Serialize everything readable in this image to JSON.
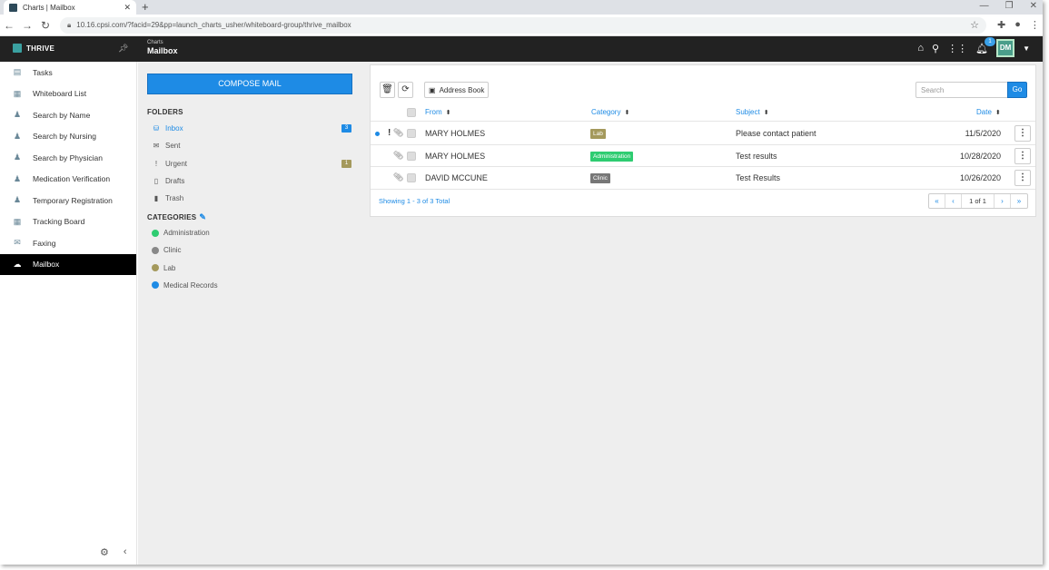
{
  "browser": {
    "tab_title": "Charts | Mailbox",
    "tab_close": "✕",
    "new_tab": "+",
    "url": "10.16.cpsi.com/?facid=29&pp=launch_charts_usher/whiteboard-group/thrive_mailbox"
  },
  "app": {
    "brand": "THRIVE",
    "breadcrumb_sub": "Charts",
    "breadcrumb_title": "Mailbox",
    "notification_count": "1",
    "user_initials": "DM"
  },
  "sidebar": {
    "items": [
      {
        "label": "Tasks",
        "icon": "tasks-icon",
        "glyph": "▤"
      },
      {
        "label": "Whiteboard List",
        "icon": "whiteboard-icon",
        "glyph": "▦"
      },
      {
        "label": "Search by Name",
        "icon": "user-search-icon",
        "glyph": "♟"
      },
      {
        "label": "Search by Nursing",
        "icon": "nurse-icon",
        "glyph": "♟"
      },
      {
        "label": "Search by Physician",
        "icon": "physician-icon",
        "glyph": "♟"
      },
      {
        "label": "Medication Verification",
        "icon": "medication-icon",
        "glyph": "♟"
      },
      {
        "label": "Temporary Registration",
        "icon": "registration-icon",
        "glyph": "♟"
      },
      {
        "label": "Tracking Board",
        "icon": "tracking-board-icon",
        "glyph": "▦"
      },
      {
        "label": "Faxing",
        "icon": "fax-icon",
        "glyph": "✉"
      },
      {
        "label": "Mailbox",
        "icon": "mailbox-icon",
        "glyph": "☁"
      }
    ]
  },
  "mail": {
    "compose_label": "COMPOSE MAIL",
    "folders_heading": "FOLDERS",
    "folders": [
      {
        "label": "Inbox",
        "icon": "inbox-icon",
        "glyph": "⛁",
        "badge": "3",
        "badge_color": "#1e8be5"
      },
      {
        "label": "Sent",
        "icon": "sent-icon",
        "glyph": "✉",
        "badge": "",
        "badge_color": ""
      },
      {
        "label": "Urgent",
        "icon": "urgent-icon",
        "glyph": "!",
        "badge": "1",
        "badge_color": "#a4995c"
      },
      {
        "label": "Drafts",
        "icon": "drafts-icon",
        "glyph": "▯",
        "badge": "",
        "badge_color": ""
      },
      {
        "label": "Trash",
        "icon": "trash-icon",
        "glyph": "▮",
        "badge": "",
        "badge_color": ""
      }
    ],
    "categories_heading": "CATEGORIES",
    "categories": [
      {
        "label": "Administration",
        "color": "#2ecc71"
      },
      {
        "label": "Clinic",
        "color": "#888888"
      },
      {
        "label": "Lab",
        "color": "#a4995c"
      },
      {
        "label": "Medical Records",
        "color": "#1e8be5"
      }
    ],
    "toolbar": {
      "address_book_label": "Address Book",
      "search_placeholder": "Search",
      "go_label": "Go"
    },
    "columns": {
      "from": "From",
      "category": "Category",
      "subject": "Subject",
      "date": "Date"
    },
    "rows": [
      {
        "from": "MARY HOLMES",
        "category": "Lab",
        "category_color": "#a4995c",
        "subject": "Please contact patient",
        "date": "11/5/2020",
        "unread": true,
        "urgent": true
      },
      {
        "from": "MARY HOLMES",
        "category": "Administration",
        "category_color": "#2ecc71",
        "subject": "Test results",
        "date": "10/28/2020",
        "unread": false,
        "urgent": false
      },
      {
        "from": "DAVID MCCUNE",
        "category": "Clinic",
        "category_color": "#777777",
        "subject": "Test Results",
        "date": "10/26/2020",
        "unread": false,
        "urgent": false
      }
    ],
    "showing_text": "Showing 1 - 3 of 3 Total",
    "pager_text": "1 of 1"
  }
}
